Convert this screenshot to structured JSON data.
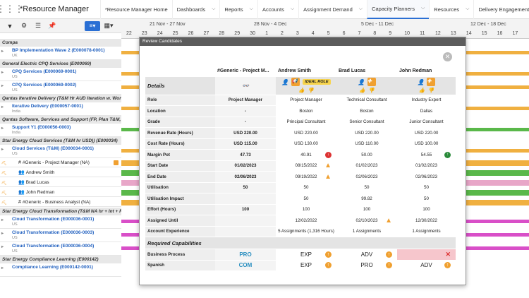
{
  "app": {
    "title": "*Resource Manager"
  },
  "nav_tabs": [
    {
      "label": "*Resource Manager Home"
    },
    {
      "label": "Dashboards"
    },
    {
      "label": "Reports"
    },
    {
      "label": "Accounts"
    },
    {
      "label": "Assignment Demand"
    },
    {
      "label": "Capacity Planners"
    },
    {
      "label": "Resources"
    },
    {
      "label": "Delivery Engagements"
    }
  ],
  "active_tab": "Capacity Planners",
  "timeline": {
    "weeks": [
      "21 Nov - 27 Nov",
      "28 Nov - 4 Dec",
      "5 Dec - 11 Dec",
      "12 Dec - 18 Dec"
    ],
    "days": [
      "22",
      "23",
      "24",
      "25",
      "26",
      "27",
      "28",
      "29",
      "30",
      "1",
      "2",
      "3",
      "4",
      "5",
      "6",
      "7",
      "8",
      "9",
      "10",
      "11",
      "12",
      "13",
      "14",
      "15",
      "16",
      "17"
    ]
  },
  "left_rows": [
    {
      "type": "grp",
      "text": "Compa"
    },
    {
      "type": "proj",
      "text": "BP Implementation Wave 2 (E000078-0001)",
      "sub": "UK"
    },
    {
      "type": "grp",
      "text": "General Electric CPQ Services (E000069)"
    },
    {
      "type": "proj",
      "text": "CPQ Services (E000069-0001)",
      "sub": "US"
    },
    {
      "type": "proj",
      "text": "CPQ Services (E000069-0002)",
      "sub": "US"
    },
    {
      "type": "grp",
      "text": "Qantas Iterative Delivery (T&M Hr AUD Iteration w. Work Ite"
    },
    {
      "type": "proj",
      "text": "Iterative Delivery (E000057-0001)",
      "sub": "India"
    },
    {
      "type": "grp",
      "text": "Qantas Software, Services and Support (FP, Plan T&M, Lic"
    },
    {
      "type": "proj",
      "text": "Support Y1 (E000056-0003)",
      "sub": "India"
    },
    {
      "type": "grp",
      "text": "Star Energy Cloud Services (T&M hr USD)) (E000034)"
    },
    {
      "type": "proj",
      "text": "Cloud Services (T&M) (E000034-0001)",
      "sub": "US"
    },
    {
      "type": "res",
      "text": "#Generic - Project Manager (NA)"
    },
    {
      "type": "res",
      "text": "Andrew Smith"
    },
    {
      "type": "res",
      "text": "Brad Lucas"
    },
    {
      "type": "res",
      "text": "John Redman"
    },
    {
      "type": "res",
      "text": "#Generic - Business Analyst (NA)"
    },
    {
      "type": "grp",
      "text": "Star Energy Cloud Transformation (T&M NA hr + Int + Rev I"
    },
    {
      "type": "proj",
      "text": "Cloud Transformation (E000036-0001)",
      "sub": "US"
    },
    {
      "type": "proj",
      "text": "Cloud Transformation (E000036-0003)",
      "sub": "US"
    },
    {
      "type": "proj",
      "text": "Cloud Transformation (E000036-0004)",
      "sub": "US"
    },
    {
      "type": "grp",
      "text": "Star Energy Compliance Learning (E000142)"
    },
    {
      "type": "proj",
      "text": "Compliance Learning (E000142-0001)",
      "sub": ""
    }
  ],
  "modal": {
    "title": "Review Candidates",
    "columns": [
      "#Generic - Project M...",
      "Andrew Smith",
      "Brad Lucas",
      "John Redman"
    ],
    "details_label": "Details",
    "ideal_role_label": "IDEAL ROLE",
    "rows": [
      {
        "label": "Role",
        "values": [
          "Project Manager",
          "Project Manager",
          "Technical Consultant",
          "Industry Expert"
        ]
      },
      {
        "label": "Location",
        "values": [
          "-",
          "Boston",
          "Boston",
          "Dallas"
        ]
      },
      {
        "label": "Grade",
        "values": [
          "-",
          "Principal Consultant",
          "Senior Consultant",
          "Junior Consultant"
        ]
      },
      {
        "label": "Revenue Rate (Hours)",
        "values": [
          "USD 220.00",
          "USD 220.00",
          "USD 220.00",
          "USD 220.00"
        ]
      },
      {
        "label": "Cost Rate (Hours)",
        "values": [
          "USD 115.00",
          "USD 130.00",
          "USD 110.00",
          "USD 100.00"
        ]
      },
      {
        "label": "Margin Pot",
        "values": [
          "47.73",
          "40.91",
          "50.00",
          "54.55"
        ]
      },
      {
        "label": "Start Date",
        "values": [
          "01/02/2023",
          "08/15/2022",
          "01/02/2023",
          "01/02/2023"
        ]
      },
      {
        "label": "End Date",
        "values": [
          "02/06/2023",
          "09/19/2022",
          "02/06/2023",
          "02/06/2023"
        ]
      },
      {
        "label": "Utilisation",
        "values": [
          "50",
          "50",
          "50",
          "50"
        ]
      },
      {
        "label": "Utilisation Impact",
        "values": [
          "",
          "50",
          "99.82",
          "50"
        ]
      },
      {
        "label": "Effort (Hours)",
        "values": [
          "100",
          "100",
          "100",
          "100"
        ]
      },
      {
        "label": "Assigned Until",
        "values": [
          "",
          "12/02/2022",
          "02/10/2023",
          "12/30/2022"
        ]
      },
      {
        "label": "Account Experience",
        "values": [
          "",
          "5 Assignments (1,316 Hours)",
          "1 Assignments",
          "1 Assignments"
        ]
      }
    ],
    "capabilities_label": "Required Capabilities",
    "capabilities": [
      {
        "label": "Business Process",
        "values": [
          "PRO",
          "EXP",
          "ADV",
          ""
        ]
      },
      {
        "label": "Spanish",
        "values": [
          "COM",
          "EXP",
          "PRO",
          "ADV"
        ]
      }
    ]
  }
}
